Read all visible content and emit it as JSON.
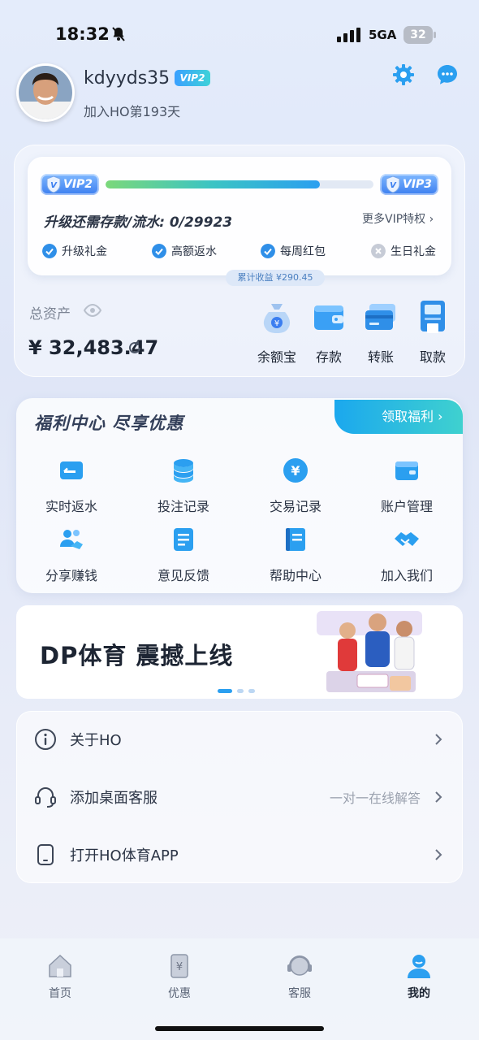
{
  "status_bar": {
    "time": "18:32",
    "network": "5GA",
    "battery": "32"
  },
  "profile": {
    "username": "kdyyds35",
    "vip_badge": "VIP2",
    "join_text": "加入HO第193天"
  },
  "vip": {
    "current_level": "VIP2",
    "next_level": "VIP3",
    "progress": 0.8,
    "upgrade_text": "升级还需存款/流水: 0/29923",
    "more_link": "更多VIP特权 ›",
    "perks": [
      {
        "label": "升级礼金",
        "enabled": true
      },
      {
        "label": "高额返水",
        "enabled": true
      },
      {
        "label": "每周红包",
        "enabled": true
      },
      {
        "label": "生日礼金",
        "enabled": false
      }
    ],
    "earnings": "累计收益 ¥290.45"
  },
  "assets": {
    "label": "总资产",
    "value": "¥ 32,483.47",
    "actions": [
      {
        "label": "余额宝",
        "icon": "money-bag-icon"
      },
      {
        "label": "存款",
        "icon": "wallet-icon"
      },
      {
        "label": "转账",
        "icon": "card-transfer-icon"
      },
      {
        "label": "取款",
        "icon": "atm-icon"
      }
    ]
  },
  "welfare": {
    "title": "福利中心  尽享优惠",
    "claim_button": "领取福利 ›",
    "items": [
      {
        "label": "实时返水",
        "icon": "rebate-icon"
      },
      {
        "label": "投注记录",
        "icon": "bet-record-icon"
      },
      {
        "label": "交易记录",
        "icon": "transaction-icon"
      },
      {
        "label": "账户管理",
        "icon": "account-icon"
      },
      {
        "label": "分享赚钱",
        "icon": "share-icon"
      },
      {
        "label": "意见反馈",
        "icon": "feedback-icon"
      },
      {
        "label": "帮助中心",
        "icon": "help-icon"
      },
      {
        "label": "加入我们",
        "icon": "handshake-icon"
      }
    ]
  },
  "banner": {
    "title": "DP体育 震撼上线",
    "active_slide": 0,
    "slides": 3
  },
  "settings": [
    {
      "label": "关于HO",
      "hint": "",
      "icon": "info-icon"
    },
    {
      "label": "添加桌面客服",
      "hint": "一对一在线解答",
      "icon": "headset-icon"
    },
    {
      "label": "打开HO体育APP",
      "hint": "",
      "icon": "phone-icon"
    }
  ],
  "tabs": [
    {
      "label": "首页",
      "icon": "home-icon",
      "active": false
    },
    {
      "label": "优惠",
      "icon": "coupon-icon",
      "active": false
    },
    {
      "label": "客服",
      "icon": "support-icon",
      "active": false
    },
    {
      "label": "我的",
      "icon": "profile-icon",
      "active": true
    }
  ],
  "colors": {
    "accent": "#2b9ff0",
    "teal": "#3fd1cf"
  }
}
